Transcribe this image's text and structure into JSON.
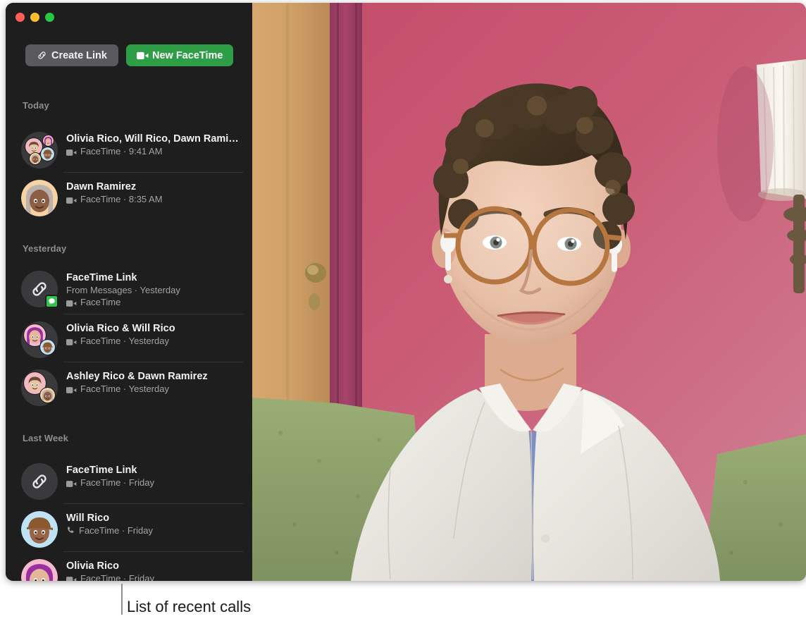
{
  "window": {
    "traffic_lights": [
      {
        "name": "close",
        "color": "#ff5f57"
      },
      {
        "name": "minimize",
        "color": "#febc2e"
      },
      {
        "name": "zoom",
        "color": "#28c840"
      }
    ]
  },
  "toolbar": {
    "create_link_label": "Create Link",
    "create_link_icon": "link-icon",
    "new_facetime_label": "New FaceTime",
    "new_facetime_icon": "video-camera-icon",
    "create_link_color": "#5a5a5e",
    "new_facetime_color": "#2d9e45"
  },
  "sidebar": {
    "background": "#1e1e1e",
    "sections": [
      {
        "header": "Today",
        "rows": [
          {
            "title": "Olivia Rico, Will Rico, Dawn Rami…",
            "sub_icon": "video-camera-icon",
            "sub": "FaceTime · 9:41 AM",
            "avatar": "group-4",
            "separator": true
          },
          {
            "title": "Dawn Ramirez",
            "sub_icon": "video-camera-icon",
            "sub": "FaceTime · 8:35 AM",
            "avatar": "memoji-dawn",
            "separator": false
          }
        ]
      },
      {
        "header": "Yesterday",
        "rows": [
          {
            "title": "FaceTime Link",
            "sub_plain": "From Messages · Yesterday",
            "sub_icon": "video-camera-icon",
            "sub": "FaceTime",
            "avatar": "link-badge-messages",
            "separator": true
          },
          {
            "title": "Olivia Rico & Will Rico",
            "sub_icon": "video-camera-icon",
            "sub": "FaceTime · Yesterday",
            "avatar": "group-2-olivia-will",
            "separator": true
          },
          {
            "title": "Ashley Rico & Dawn Ramirez",
            "sub_icon": "video-camera-icon",
            "sub": "FaceTime · Yesterday",
            "avatar": "group-2-ashley-dawn",
            "separator": false
          }
        ]
      },
      {
        "header": "Last Week",
        "rows": [
          {
            "title": "FaceTime Link",
            "sub_icon": "video-camera-icon",
            "sub": "FaceTime · Friday",
            "avatar": "link",
            "separator": true
          },
          {
            "title": "Will Rico",
            "sub_icon": "phone-icon",
            "sub": "FaceTime · Friday",
            "avatar": "memoji-will",
            "separator": true
          },
          {
            "title": "Olivia Rico",
            "sub_icon": "video-camera-icon",
            "sub": "FaceTime · Friday",
            "avatar": "memoji-olivia",
            "separator": false
          }
        ]
      }
    ]
  },
  "video": {
    "description": "self-view video of a person with short curly brown hair, tortoiseshell round glasses, white camp shirt over blue tee, seated on a green sofa in front of a pink wall with a wooden door and a white pleated lamp shade",
    "wall_color": "#c7566f",
    "door_color": "#d2a169",
    "sofa_color": "#8fa46a",
    "shirt_color": "#e9e7e0",
    "tee_color": "#7f8fc4"
  },
  "caption": {
    "text": "List of recent calls"
  }
}
